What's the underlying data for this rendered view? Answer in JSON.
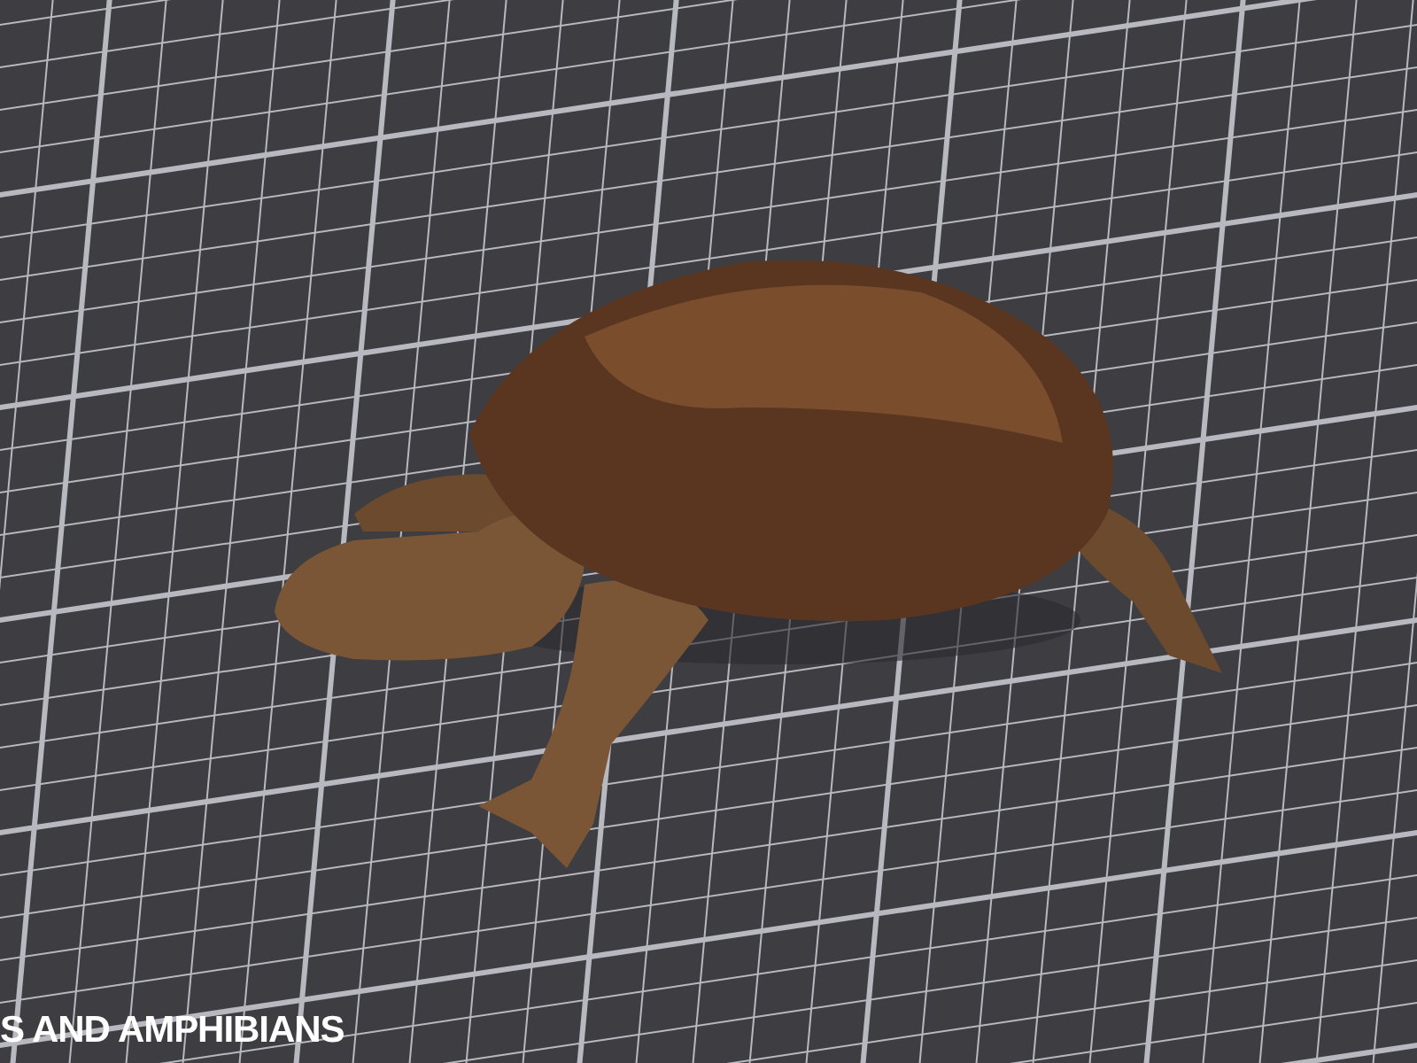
{
  "caption": {
    "text": "S AND AMPHIBIANS"
  }
}
